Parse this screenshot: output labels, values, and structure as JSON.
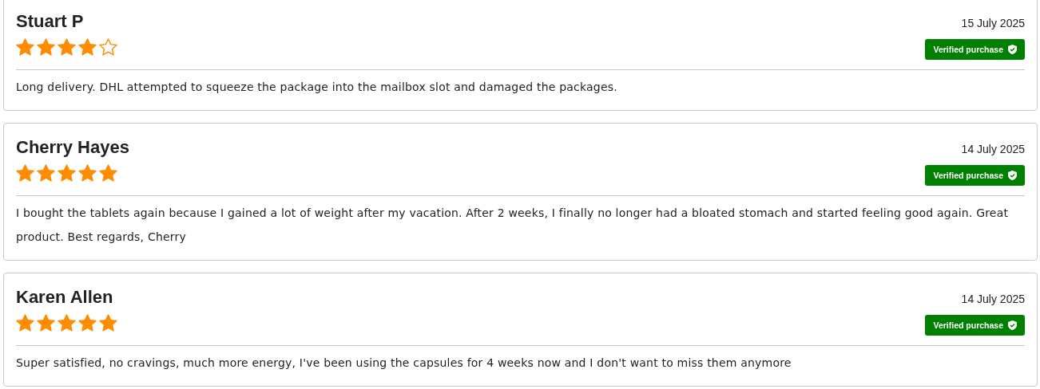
{
  "reviews": [
    {
      "name": "Stuart P",
      "date": "15 July 2025",
      "stars": 4,
      "verified": true,
      "badge": "Verified purchase",
      "text": "Long delivery. DHL attempted to squeeze the package into the mailbox slot and damaged the packages."
    },
    {
      "name": "Cherry Hayes",
      "date": "14 July 2025",
      "stars": 5,
      "verified": true,
      "badge": "Verified purchase",
      "text": "I bought the tablets again because I gained a lot of weight after my vacation. After 2 weeks, I finally no longer had a bloated stomach and started feeling good again. Great product. Best regards, Cherry"
    },
    {
      "name": "Karen Allen",
      "date": "14 July 2025",
      "stars": 5,
      "verified": true,
      "badge": "Verified purchase",
      "text": "Super satisfied, no cravings, much more energy, I've been using the capsules for 4 weeks now and I don't want to miss them anymore"
    }
  ]
}
